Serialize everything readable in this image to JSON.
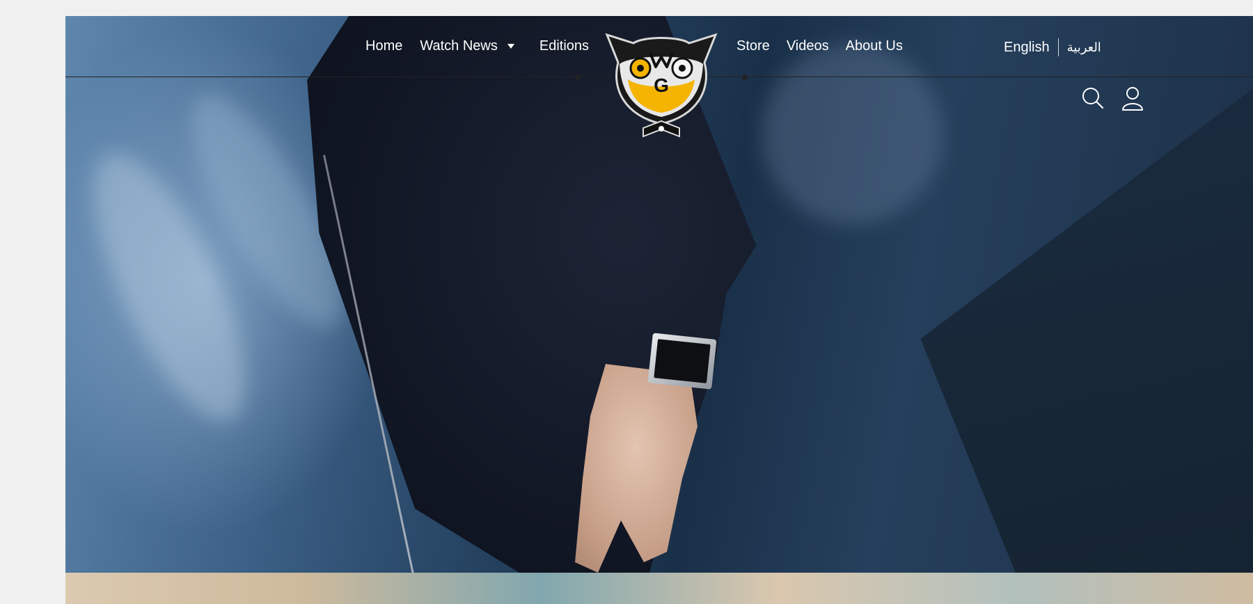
{
  "nav": {
    "left": [
      {
        "label": "Home"
      },
      {
        "label": "Watch News",
        "has_dropdown": true
      },
      {
        "label": "Editions"
      }
    ],
    "right": [
      {
        "label": "Store"
      },
      {
        "label": "Videos"
      },
      {
        "label": "About Us"
      }
    ]
  },
  "language": {
    "english": "English",
    "arabic": "العربية"
  },
  "logo": {
    "letters": "WG"
  },
  "icons": {
    "search": "search-icon",
    "account": "user-icon",
    "dropdown": "caret-down-icon"
  },
  "colors": {
    "nav_text": "#ffffff",
    "logo_gold": "#f5b400",
    "logo_dark": "#111111",
    "page_bg": "#f0f0f0"
  }
}
